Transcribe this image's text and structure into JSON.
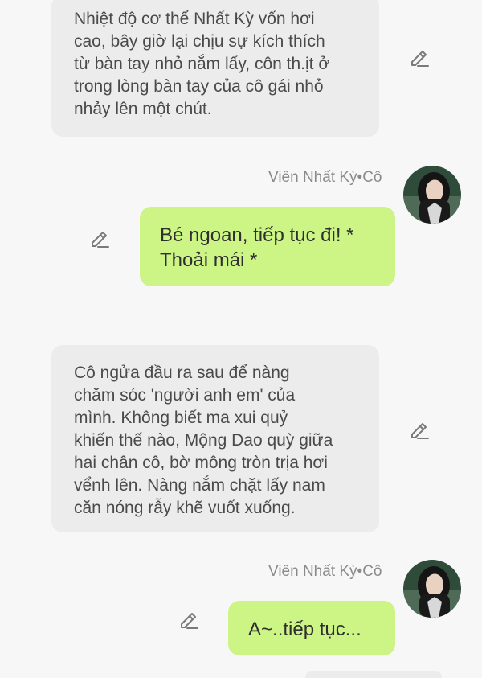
{
  "messages": [
    {
      "side": "incoming",
      "text": "Nhiệt độ cơ thể Nhất Kỳ vốn hơi\ncao, bây giờ lại chịu sự kích thích\ntừ bàn tay nhỏ nắm lấy, côn th.ịt ở\ntrong lòng bàn tay của cô gái nhỏ\nnhảy lên một chút."
    },
    {
      "side": "outgoing",
      "sender": "Viên Nhất Kỳ•Cô",
      "text": "Bé ngoan, tiếp tục đi! *\nThoải mái *"
    },
    {
      "side": "incoming",
      "text": "Cô ngửa đầu ra sau để nàng\nchăm sóc 'người anh em' của\nmình. Không biết ma xui quỷ\nkhiến thế nào, Mộng Dao quỳ giữa\nhai chân cô, bờ mông tròn trịa hơi\nvểnh lên. Nàng nắm chặt lấy nam\ncăn nóng rẫy khẽ vuốt xuống."
    },
    {
      "side": "outgoing",
      "sender": "Viên Nhất Kỳ•Cô",
      "text": "A~..tiếp tục..."
    }
  ],
  "icons": {
    "edit": "pencil-edit-icon",
    "avatar": "character-avatar"
  },
  "colors": {
    "background": "#f7f7f7",
    "incoming_bubble": "#ececec",
    "outgoing_bubble": "#cdf586",
    "sender_name": "#8a8a8a"
  }
}
